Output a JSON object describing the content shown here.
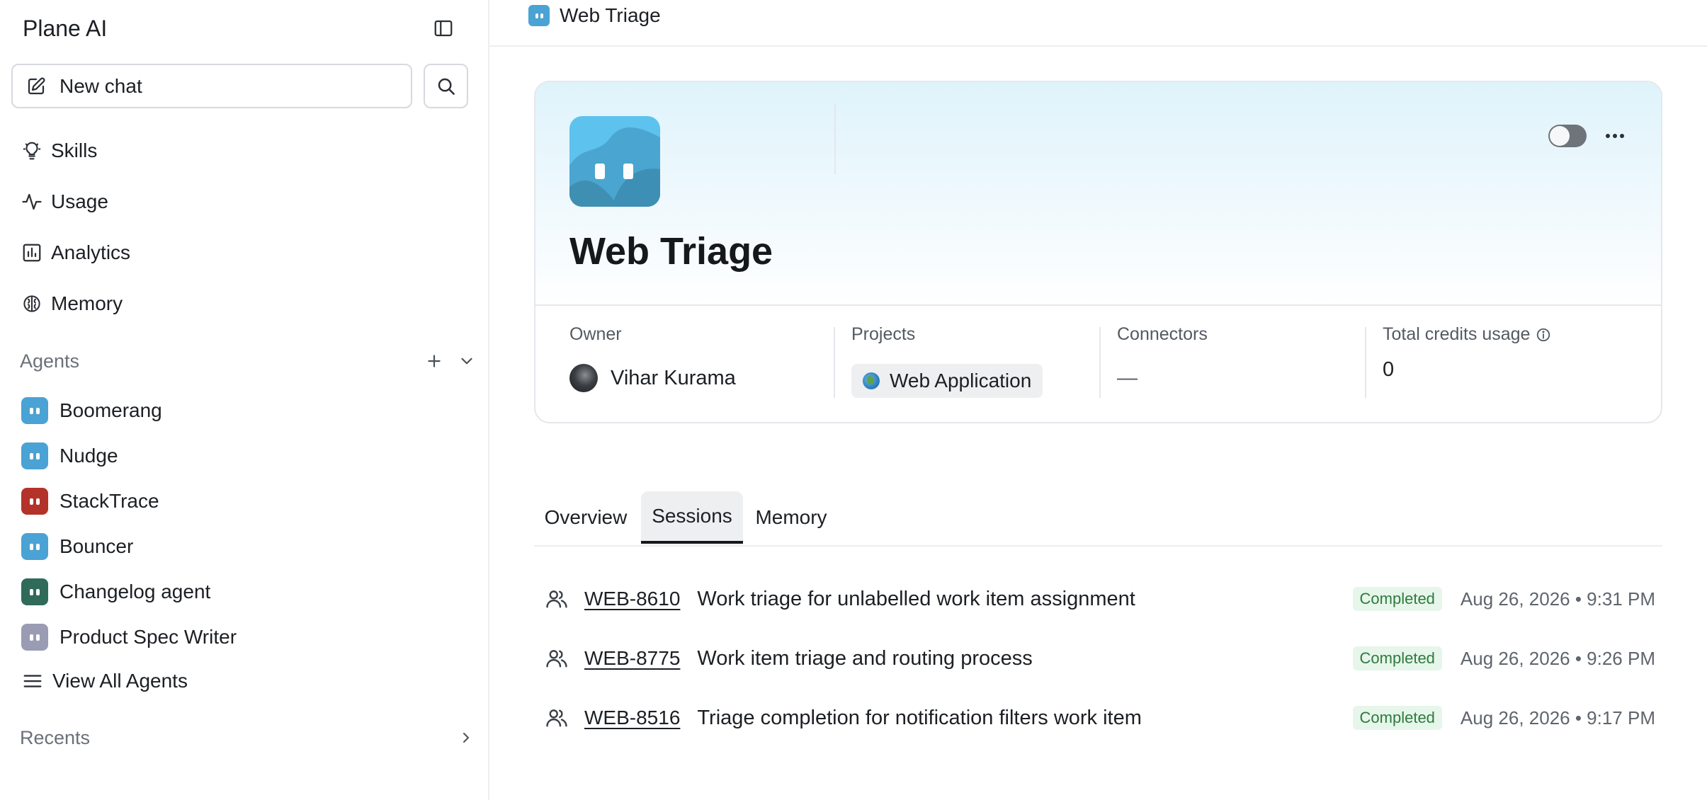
{
  "sidebar": {
    "brand": "Plane AI",
    "new_chat": "New chat",
    "nav": [
      {
        "label": "Skills",
        "icon": "lightbulb-icon"
      },
      {
        "label": "Usage",
        "icon": "activity-icon"
      },
      {
        "label": "Analytics",
        "icon": "bar-chart-icon"
      },
      {
        "label": "Memory",
        "icon": "brain-icon"
      }
    ],
    "agents_heading": "Agents",
    "agents": [
      {
        "label": "Boomerang",
        "color": "#4aa3d4"
      },
      {
        "label": "Nudge",
        "color": "#4aa3d4"
      },
      {
        "label": "StackTrace",
        "color": "#b3332a"
      },
      {
        "label": "Bouncer",
        "color": "#4aa3d4"
      },
      {
        "label": "Changelog agent",
        "color": "#2f6b58"
      },
      {
        "label": "Product Spec Writer",
        "color": "#9a9cb3"
      }
    ],
    "view_all": "View All Agents",
    "recents_heading": "Recents"
  },
  "header": {
    "breadcrumb": "Web Triage"
  },
  "agent_card": {
    "title": "Web Triage",
    "owner_label": "Owner",
    "owner_name": "Vihar Kurama",
    "projects_label": "Projects",
    "project_name": "Web Application",
    "connectors_label": "Connectors",
    "connectors_value": "—",
    "credits_label": "Total credits usage",
    "credits_value": "0",
    "enabled": false
  },
  "tabs": [
    {
      "label": "Overview",
      "active": false
    },
    {
      "label": "Sessions",
      "active": true
    },
    {
      "label": "Memory",
      "active": false
    }
  ],
  "sessions": [
    {
      "id": "WEB-8610",
      "title": "Work triage for unlabelled work item assignment",
      "status": "Completed",
      "date": "Aug 26, 2026 • 9:31 PM"
    },
    {
      "id": "WEB-8775",
      "title": "Work item triage and routing process",
      "status": "Completed",
      "date": "Aug 26, 2026 • 9:26 PM"
    },
    {
      "id": "WEB-8516",
      "title": "Triage completion for notification filters work item",
      "status": "Completed",
      "date": "Aug 26, 2026 • 9:17 PM"
    }
  ],
  "colors": {
    "agent_blue": "#4aa3d4",
    "status_green": "#2f7a3e",
    "status_green_bg": "#e6f6ea"
  }
}
